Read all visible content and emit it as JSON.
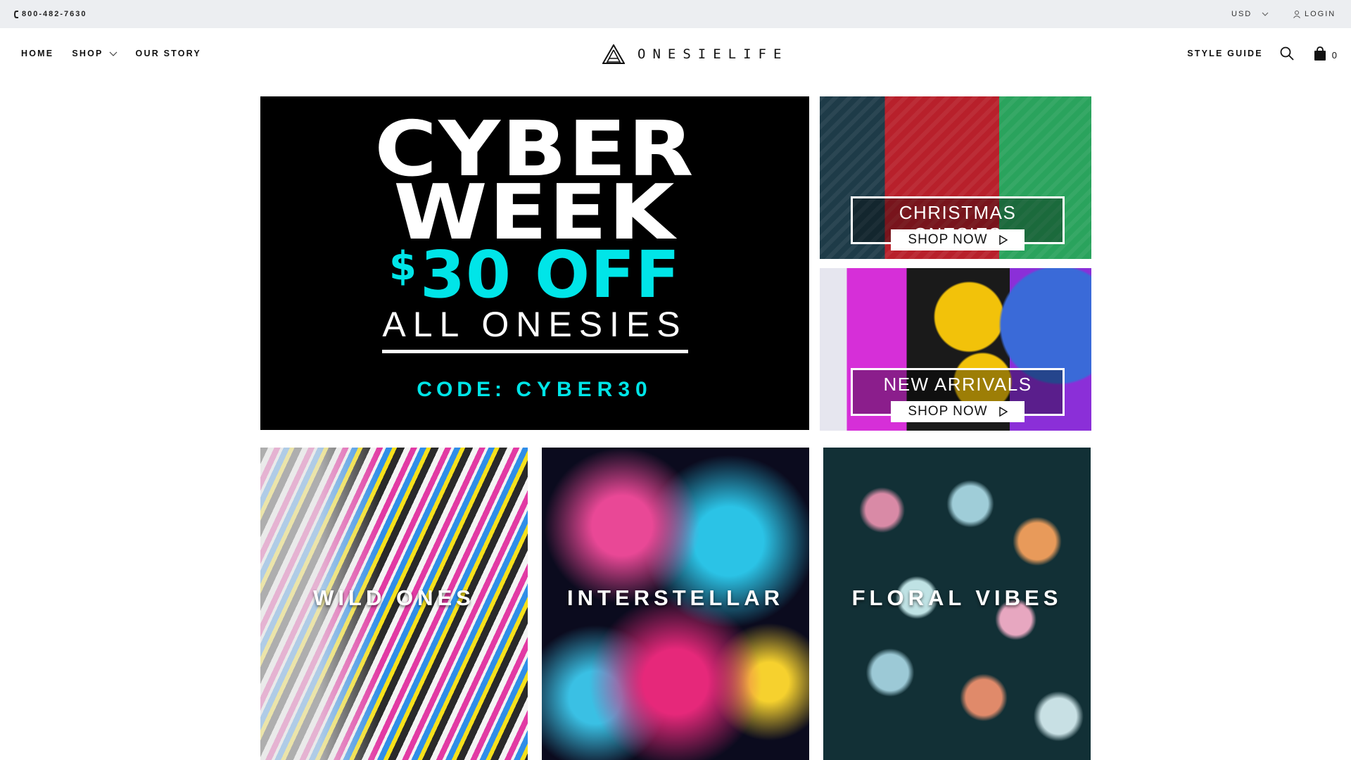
{
  "topbar": {
    "phone": "800-482-7630",
    "currency": "USD",
    "login": "LOGIN"
  },
  "nav": {
    "left": [
      "HOME",
      "SHOP",
      "OUR STORY"
    ],
    "logo_text": "ONESIELIFE",
    "style_guide": "STYLE GUIDE",
    "cart_count": "0"
  },
  "hero": {
    "line1": "CYBER",
    "line2": "WEEK",
    "offer_symbol": "$",
    "offer_text": "30 OFF",
    "subline": "ALL ONESIES",
    "code_label": "CODE:",
    "code_value": "CYBER30"
  },
  "promos": [
    {
      "title": "CHRISTMAS ONESIES",
      "button": "SHOP NOW"
    },
    {
      "title": "NEW ARRIVALS",
      "button": "SHOP NOW"
    }
  ],
  "collections": [
    "WILD ONES",
    "INTERSTELLAR",
    "FLORAL VIBES"
  ],
  "colors": {
    "accent": "#00e5e8",
    "topbar": "#eceef1"
  }
}
